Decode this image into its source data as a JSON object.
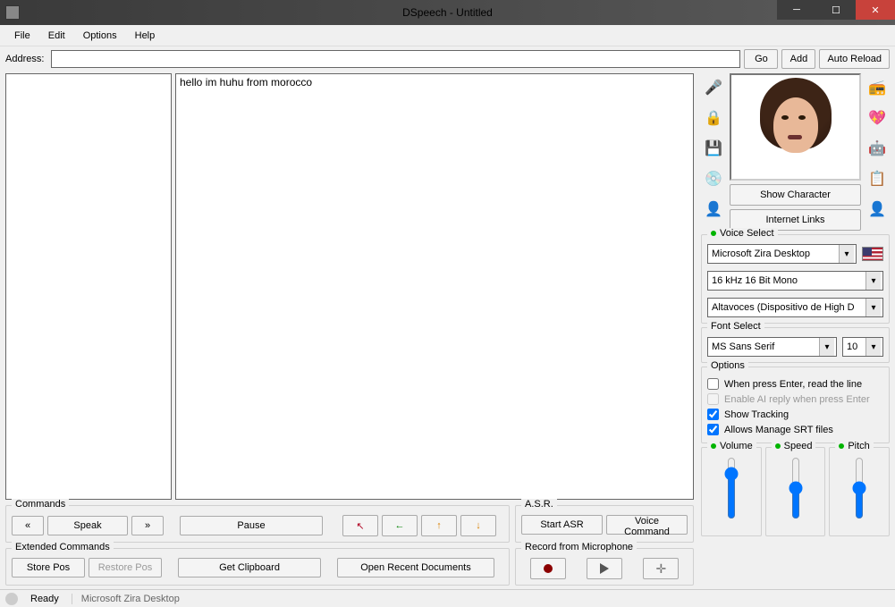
{
  "window": {
    "title": "DSpeech - Untitled"
  },
  "menu": {
    "file": "File",
    "edit": "Edit",
    "options": "Options",
    "help": "Help"
  },
  "address": {
    "label": "Address:",
    "value": "",
    "go": "Go",
    "add": "Add",
    "autoreload": "Auto Reload"
  },
  "editor": {
    "text": "hello im huhu from morocco"
  },
  "commands": {
    "legend": "Commands",
    "prev": "«",
    "speak": "Speak",
    "next": "»",
    "pause": "Pause"
  },
  "extcommands": {
    "legend": "Extended Commands",
    "storepos": "Store Pos",
    "restorepos": "Restore Pos",
    "getclipboard": "Get Clipboard",
    "openrecent": "Open Recent Documents"
  },
  "asr": {
    "legend": "A.S.R.",
    "start": "Start ASR",
    "voicecmd": "Voice Command"
  },
  "record": {
    "legend": "Record from Microphone"
  },
  "character": {
    "show": "Show Character",
    "links": "Internet Links"
  },
  "voiceselect": {
    "legend": "Voice Select",
    "voice": "Microsoft Zira Desktop",
    "format": "16 kHz 16 Bit Mono",
    "device": "Altavoces (Dispositivo de High D"
  },
  "fontselect": {
    "legend": "Font Select",
    "font": "MS Sans Serif",
    "size": "10"
  },
  "options": {
    "legend": "Options",
    "enterread": "When press Enter, read the line",
    "aireply": "Enable AI reply when press Enter",
    "tracking": "Show Tracking",
    "srt": "Allows Manage SRT files"
  },
  "sliders": {
    "volume": "Volume",
    "speed": "Speed",
    "pitch": "Pitch"
  },
  "status": {
    "ready": "Ready",
    "voice": "Microsoft Zira Desktop"
  }
}
